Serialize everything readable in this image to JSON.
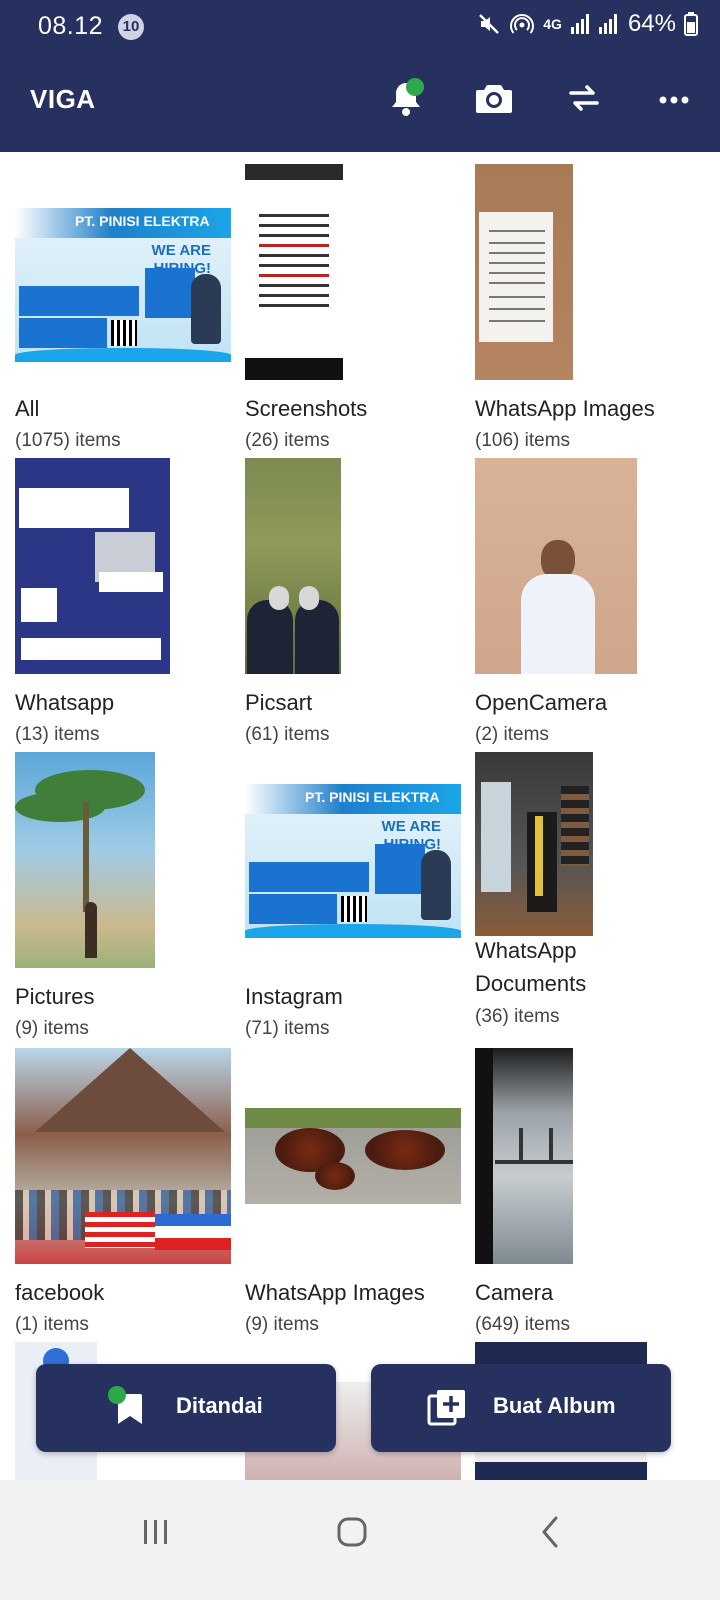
{
  "status_bar": {
    "time": "08.12",
    "notification_count": "10",
    "network": "4G",
    "battery": "64%"
  },
  "app_bar": {
    "title": "VIGA",
    "icons": [
      "bell-icon",
      "camera-icon",
      "swap-icon",
      "more-icon"
    ]
  },
  "albums": [
    {
      "name": "All",
      "count": "(1075) items"
    },
    {
      "name": "Screenshots",
      "count": "(26) items"
    },
    {
      "name": "WhatsApp Images",
      "count": "(106) items"
    },
    {
      "name": "Whatsapp",
      "count": "(13) items"
    },
    {
      "name": "Picsart",
      "count": "(61) items"
    },
    {
      "name": "OpenCamera",
      "count": "(2) items"
    },
    {
      "name": "Pictures",
      "count": "(9) items"
    },
    {
      "name": "Instagram",
      "count": "(71) items"
    },
    {
      "name": "WhatsApp Documents",
      "name_line1": "WhatsApp",
      "name_line2": "Documents",
      "count": "(36) items"
    },
    {
      "name": "facebook",
      "count": "(1) items"
    },
    {
      "name": "WhatsApp Images",
      "count": "(9) items"
    },
    {
      "name": "Camera",
      "count": "(649) items"
    }
  ],
  "thumb_text": {
    "company": "PT. PINISI ELEKTRA",
    "hiring": "WE ARE HIRING!"
  },
  "actions": {
    "bookmarked_label": "Ditandai",
    "create_album_label": "Buat Album"
  },
  "colors": {
    "primary": "#26315f",
    "accent_green": "#2ea84b",
    "background": "#ffffff"
  }
}
